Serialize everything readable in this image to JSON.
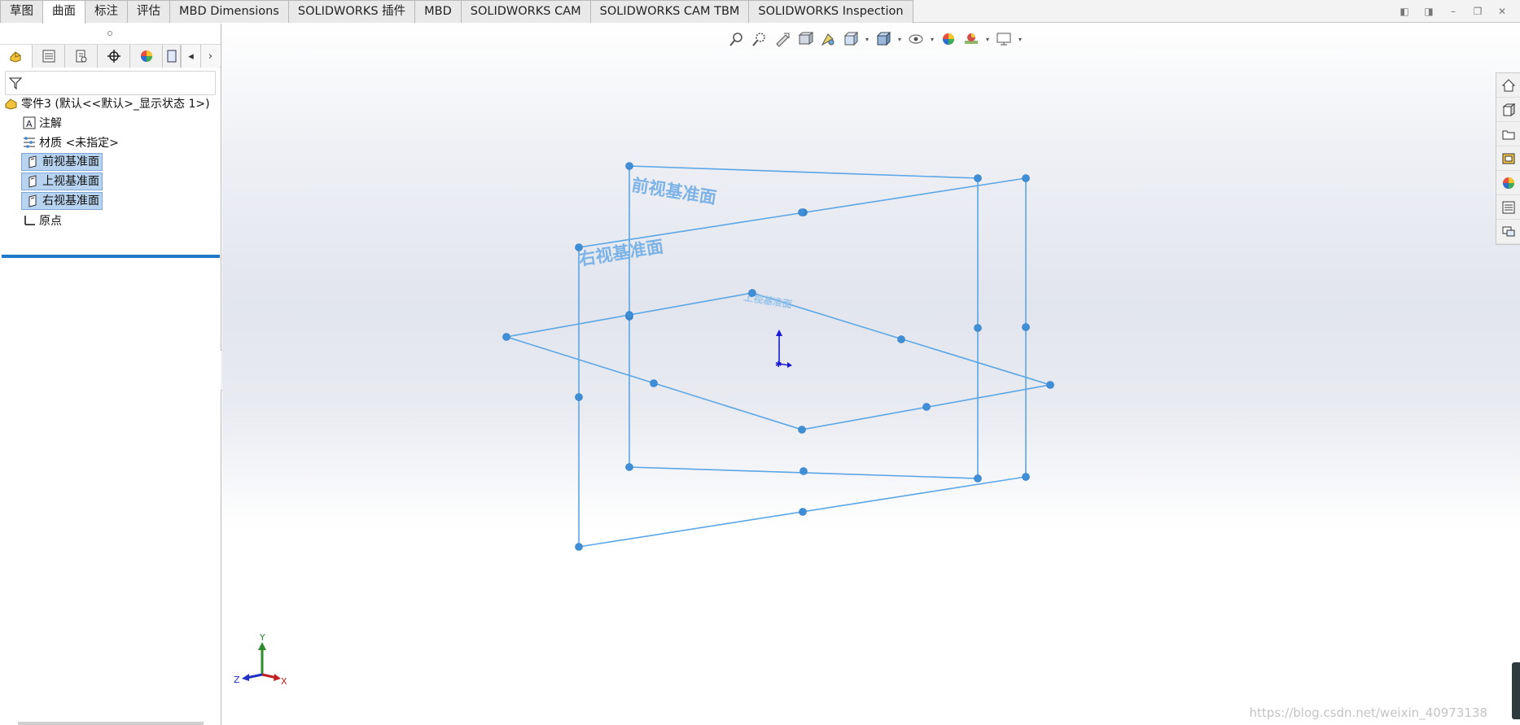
{
  "tabs": [
    {
      "label": "草图",
      "active": false
    },
    {
      "label": "曲面",
      "active": true
    },
    {
      "label": "标注",
      "active": false
    },
    {
      "label": "评估",
      "active": false
    },
    {
      "label": "MBD Dimensions",
      "active": false
    },
    {
      "label": "SOLIDWORKS 插件",
      "active": false
    },
    {
      "label": "MBD",
      "active": false
    },
    {
      "label": "SOLIDWORKS CAM",
      "active": false
    },
    {
      "label": "SOLIDWORKS CAM TBM",
      "active": false
    },
    {
      "label": "SOLIDWORKS Inspection",
      "active": false
    }
  ],
  "feature_tree": {
    "root": "零件3  (默认<<默认>_显示状态 1>)",
    "items": [
      {
        "label": "注解",
        "icon": "annotation-icon",
        "selected": false
      },
      {
        "label": "材质 <未指定>",
        "icon": "material-icon",
        "selected": false
      },
      {
        "label": "前视基准面",
        "icon": "plane-icon",
        "selected": true
      },
      {
        "label": "上视基准面",
        "icon": "plane-icon",
        "selected": true
      },
      {
        "label": "右视基准面",
        "icon": "plane-icon",
        "selected": true
      },
      {
        "label": "原点",
        "icon": "origin-icon",
        "selected": false
      }
    ]
  },
  "viewport": {
    "plane_labels": {
      "front": "前视基准面",
      "right": "右视基准面",
      "top": "上视基准面"
    },
    "triad": {
      "x": "X",
      "y": "Y",
      "z": "Z"
    }
  },
  "watermark": "https://blog.csdn.net/weixin_40973138",
  "colors": {
    "plane_line": "#5aa6e6",
    "plane_handle": "#3e8fd8",
    "selection_bg": "#b7d3ef",
    "rollback_bar": "#1f78c8"
  }
}
